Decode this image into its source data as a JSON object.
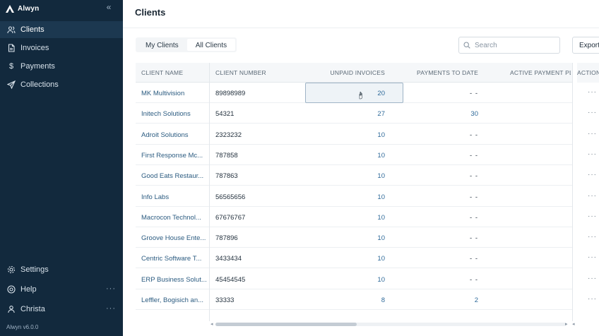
{
  "app": {
    "name": "Alwyn",
    "version": "Alwyn v6.0.0"
  },
  "sidebar": {
    "items": [
      {
        "label": "Clients",
        "icon": "users-icon",
        "active": true
      },
      {
        "label": "Invoices",
        "icon": "document-icon",
        "active": false
      },
      {
        "label": "Payments",
        "icon": "dollar-icon",
        "active": false
      },
      {
        "label": "Collections",
        "icon": "send-icon",
        "active": false
      }
    ],
    "bottom": [
      {
        "label": "Settings",
        "icon": "gear-icon"
      },
      {
        "label": "Help",
        "icon": "help-icon"
      },
      {
        "label": "Christa",
        "icon": "user-icon"
      }
    ]
  },
  "page": {
    "title": "Clients"
  },
  "tabs": [
    {
      "label": "My Clients",
      "selected": false
    },
    {
      "label": "All Clients",
      "selected": true
    }
  ],
  "search": {
    "placeholder": "Search"
  },
  "export": {
    "label": "Export"
  },
  "table": {
    "columns": [
      "CLIENT NAME",
      "CLIENT NUMBER",
      "UNPAID INVOICES",
      "PAYMENTS TO DATE",
      "ACTIVE PAYMENT PL",
      "ACTION"
    ],
    "rows": [
      {
        "name": "MK Multivision",
        "number": "89898989",
        "unpaid": "20",
        "payments": "- -"
      },
      {
        "name": "Initech Solutions",
        "number": "54321",
        "unpaid": "27",
        "payments": "30"
      },
      {
        "name": "Adroit Solutions",
        "number": "2323232",
        "unpaid": "10",
        "payments": "- -"
      },
      {
        "name": "First Response Mc...",
        "number": "787858",
        "unpaid": "10",
        "payments": "- -"
      },
      {
        "name": "Good Eats Restaur...",
        "number": "787863",
        "unpaid": "10",
        "payments": "- -"
      },
      {
        "name": "Info Labs",
        "number": "56565656",
        "unpaid": "10",
        "payments": "- -"
      },
      {
        "name": "Macrocon Technol...",
        "number": "67676767",
        "unpaid": "10",
        "payments": "- -"
      },
      {
        "name": "Groove House Ente...",
        "number": "787896",
        "unpaid": "10",
        "payments": "- -"
      },
      {
        "name": "Centric Software T...",
        "number": "3433434",
        "unpaid": "10",
        "payments": "- -"
      },
      {
        "name": "ERP Business Solut...",
        "number": "45454545",
        "unpaid": "10",
        "payments": "- -"
      },
      {
        "name": "Leffler, Bogisich an...",
        "number": "33333",
        "unpaid": "8",
        "payments": "2"
      }
    ],
    "action_label": "···"
  },
  "colors": {
    "sidebar_bg": "#12293d",
    "accent": "#2f6a9a"
  }
}
